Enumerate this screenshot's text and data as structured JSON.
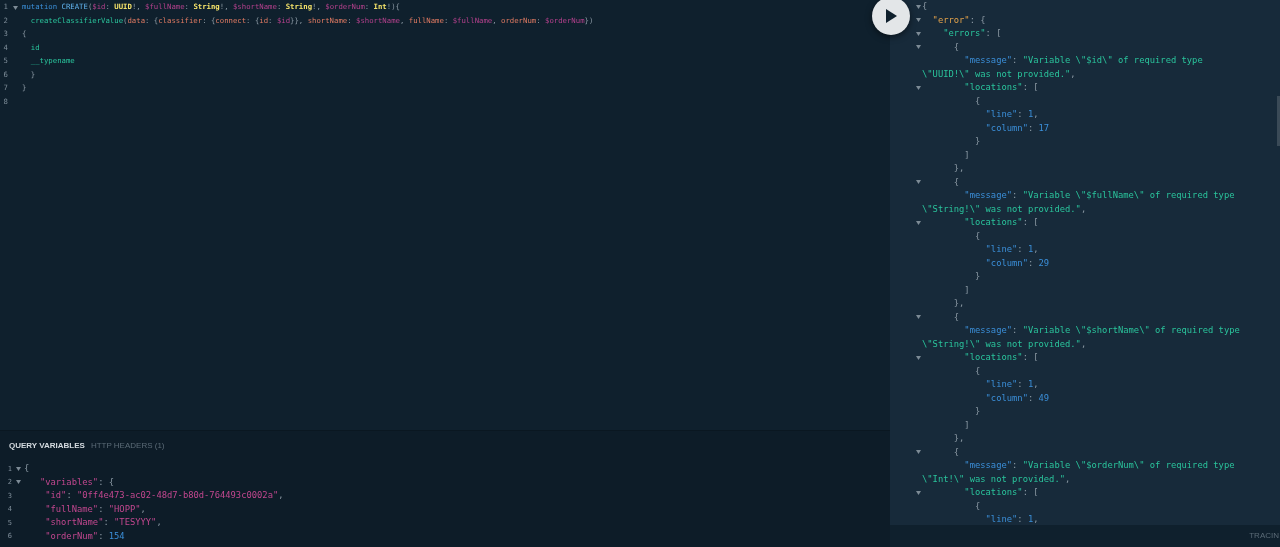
{
  "query_editor": {
    "lines": [
      {
        "number": "1",
        "fold": true,
        "tokens": [
          {
            "kind": "keyword",
            "text": "mutation "
          },
          {
            "kind": "def",
            "text": "CREATE"
          },
          {
            "kind": "punct",
            "text": "("
          },
          {
            "kind": "variable",
            "text": "$id"
          },
          {
            "kind": "punct",
            "text": ": "
          },
          {
            "kind": "type",
            "text": "UUID"
          },
          {
            "kind": "punct",
            "text": "!, "
          },
          {
            "kind": "variable",
            "text": "$fullName"
          },
          {
            "kind": "punct",
            "text": ": "
          },
          {
            "kind": "type",
            "text": "String"
          },
          {
            "kind": "punct",
            "text": "!, "
          },
          {
            "kind": "variable",
            "text": "$shortName"
          },
          {
            "kind": "punct",
            "text": ": "
          },
          {
            "kind": "type",
            "text": "String"
          },
          {
            "kind": "punct",
            "text": "!, "
          },
          {
            "kind": "variable",
            "text": "$orderNum"
          },
          {
            "kind": "punct",
            "text": ": "
          },
          {
            "kind": "type",
            "text": "Int"
          },
          {
            "kind": "punct",
            "text": "!){"
          }
        ]
      },
      {
        "number": "2",
        "fold": false,
        "tokens": [
          {
            "kind": "field",
            "text": "  createClassifierValue"
          },
          {
            "kind": "punct",
            "text": "("
          },
          {
            "kind": "arg",
            "text": "data"
          },
          {
            "kind": "punct",
            "text": ": {"
          },
          {
            "kind": "arg",
            "text": "classifier"
          },
          {
            "kind": "punct",
            "text": ": {"
          },
          {
            "kind": "arg",
            "text": "connect"
          },
          {
            "kind": "punct",
            "text": ": {"
          },
          {
            "kind": "arg",
            "text": "id"
          },
          {
            "kind": "punct",
            "text": ": "
          },
          {
            "kind": "variable",
            "text": "$id"
          },
          {
            "kind": "punct",
            "text": "}}, "
          },
          {
            "kind": "arg",
            "text": "shortName"
          },
          {
            "kind": "punct",
            "text": ": "
          },
          {
            "kind": "variable",
            "text": "$shortName"
          },
          {
            "kind": "punct",
            "text": ", "
          },
          {
            "kind": "arg",
            "text": "fullName"
          },
          {
            "kind": "punct",
            "text": ": "
          },
          {
            "kind": "variable",
            "text": "$fullName"
          },
          {
            "kind": "punct",
            "text": ", "
          },
          {
            "kind": "arg",
            "text": "orderNum"
          },
          {
            "kind": "punct",
            "text": ": "
          },
          {
            "kind": "variable",
            "text": "$orderNum"
          },
          {
            "kind": "punct",
            "text": "})"
          }
        ]
      },
      {
        "number": "3",
        "fold": false,
        "tokens": [
          {
            "kind": "punct",
            "text": "{"
          }
        ]
      },
      {
        "number": "4",
        "fold": false,
        "tokens": [
          {
            "kind": "field",
            "text": "  id"
          }
        ]
      },
      {
        "number": "5",
        "fold": false,
        "tokens": [
          {
            "kind": "field",
            "text": "  __typename"
          }
        ]
      },
      {
        "number": "6",
        "fold": false,
        "tokens": [
          {
            "kind": "punct",
            "text": "  }"
          }
        ]
      },
      {
        "number": "7",
        "fold": false,
        "tokens": [
          {
            "kind": "punct",
            "text": "}"
          }
        ]
      },
      {
        "number": "8",
        "fold": false
      }
    ]
  },
  "variables_pane": {
    "tabs": [
      {
        "label": "QUERY VARIABLES",
        "selected": true
      },
      {
        "label": "HTTP HEADERS (1)",
        "selected": false
      }
    ],
    "lines": [
      {
        "number": "1",
        "fold": true,
        "tokens": [
          {
            "kind": "punct",
            "text": "{"
          }
        ]
      },
      {
        "number": "2",
        "fold": true,
        "tokens": [
          {
            "kind": "key",
            "text": "   \"variables\""
          },
          {
            "kind": "punct",
            "text": ": {"
          }
        ]
      },
      {
        "number": "3",
        "fold": false,
        "tokens": [
          {
            "kind": "key",
            "text": "    \"id\""
          },
          {
            "kind": "punct",
            "text": ": "
          },
          {
            "kind": "string",
            "text": "\"0ff4e473-ac02-48d7-b80d-764493c0002a\""
          },
          {
            "kind": "punct",
            "text": ","
          }
        ]
      },
      {
        "number": "4",
        "fold": false,
        "tokens": [
          {
            "kind": "key",
            "text": "    \"fullName\""
          },
          {
            "kind": "punct",
            "text": ": "
          },
          {
            "kind": "string",
            "text": "\"HOPP\""
          },
          {
            "kind": "punct",
            "text": ","
          }
        ]
      },
      {
        "number": "5",
        "fold": false,
        "tokens": [
          {
            "kind": "key",
            "text": "    \"shortName\""
          },
          {
            "kind": "punct",
            "text": ": "
          },
          {
            "kind": "string",
            "text": "\"TESYYY\""
          },
          {
            "kind": "punct",
            "text": ","
          }
        ]
      },
      {
        "number": "6",
        "fold": false,
        "tokens": [
          {
            "kind": "key",
            "text": "    \"orderNum\""
          },
          {
            "kind": "punct",
            "text": ": "
          },
          {
            "kind": "number",
            "text": "154"
          }
        ]
      }
    ]
  },
  "result_pane": {
    "lines": [
      {
        "fold": true,
        "tokens": [
          {
            "kind": "punct",
            "text": "{"
          }
        ]
      },
      {
        "fold": true,
        "tokens": [
          {
            "kind": "attr",
            "text": "  \"error\""
          },
          {
            "kind": "punct",
            "text": ": {"
          }
        ]
      },
      {
        "fold": true,
        "tokens": [
          {
            "kind": "key",
            "text": "    \"errors\""
          },
          {
            "kind": "punct",
            "text": ": ["
          }
        ]
      },
      {
        "fold": true,
        "tokens": [
          {
            "kind": "punct",
            "text": "      {"
          }
        ]
      },
      {
        "fold": false,
        "tokens": [
          {
            "kind": "prop",
            "text": "        \"message\""
          },
          {
            "kind": "punct",
            "text": ": "
          },
          {
            "kind": "string",
            "text": "\"Variable \\\"$id\\\" of required type"
          }
        ]
      },
      {
        "fold": false,
        "tokens": [
          {
            "kind": "string",
            "text": "\\\"UUID!\\\" was not provided.\""
          },
          {
            "kind": "punct",
            "text": ","
          }
        ]
      },
      {
        "fold": true,
        "tokens": [
          {
            "kind": "key",
            "text": "        \"locations\""
          },
          {
            "kind": "punct",
            "text": ": ["
          }
        ]
      },
      {
        "fold": false,
        "tokens": [
          {
            "kind": "punct",
            "text": "          {"
          }
        ]
      },
      {
        "fold": false,
        "tokens": [
          {
            "kind": "prop",
            "text": "            \"line\""
          },
          {
            "kind": "punct",
            "text": ": "
          },
          {
            "kind": "number",
            "text": "1"
          },
          {
            "kind": "punct",
            "text": ","
          }
        ]
      },
      {
        "fold": false,
        "tokens": [
          {
            "kind": "prop",
            "text": "            \"column\""
          },
          {
            "kind": "punct",
            "text": ": "
          },
          {
            "kind": "number",
            "text": "17"
          }
        ]
      },
      {
        "fold": false,
        "tokens": [
          {
            "kind": "punct",
            "text": "          }"
          }
        ]
      },
      {
        "fold": false,
        "tokens": [
          {
            "kind": "punct",
            "text": "        ]"
          }
        ]
      },
      {
        "fold": false,
        "tokens": [
          {
            "kind": "punct",
            "text": "      },"
          }
        ]
      },
      {
        "fold": true,
        "tokens": [
          {
            "kind": "punct",
            "text": "      {"
          }
        ]
      },
      {
        "fold": false,
        "tokens": [
          {
            "kind": "prop",
            "text": "        \"message\""
          },
          {
            "kind": "punct",
            "text": ": "
          },
          {
            "kind": "string",
            "text": "\"Variable \\\"$fullName\\\" of required type"
          }
        ]
      },
      {
        "fold": false,
        "tokens": [
          {
            "kind": "string",
            "text": "\\\"String!\\\" was not provided.\""
          },
          {
            "kind": "punct",
            "text": ","
          }
        ]
      },
      {
        "fold": true,
        "tokens": [
          {
            "kind": "key",
            "text": "        \"locations\""
          },
          {
            "kind": "punct",
            "text": ": ["
          }
        ]
      },
      {
        "fold": false,
        "tokens": [
          {
            "kind": "punct",
            "text": "          {"
          }
        ]
      },
      {
        "fold": false,
        "tokens": [
          {
            "kind": "prop",
            "text": "            \"line\""
          },
          {
            "kind": "punct",
            "text": ": "
          },
          {
            "kind": "number",
            "text": "1"
          },
          {
            "kind": "punct",
            "text": ","
          }
        ]
      },
      {
        "fold": false,
        "tokens": [
          {
            "kind": "prop",
            "text": "            \"column\""
          },
          {
            "kind": "punct",
            "text": ": "
          },
          {
            "kind": "number",
            "text": "29"
          }
        ]
      },
      {
        "fold": false,
        "tokens": [
          {
            "kind": "punct",
            "text": "          }"
          }
        ]
      },
      {
        "fold": false,
        "tokens": [
          {
            "kind": "punct",
            "text": "        ]"
          }
        ]
      },
      {
        "fold": false,
        "tokens": [
          {
            "kind": "punct",
            "text": "      },"
          }
        ]
      },
      {
        "fold": true,
        "tokens": [
          {
            "kind": "punct",
            "text": "      {"
          }
        ]
      },
      {
        "fold": false,
        "tokens": [
          {
            "kind": "prop",
            "text": "        \"message\""
          },
          {
            "kind": "punct",
            "text": ": "
          },
          {
            "kind": "string",
            "text": "\"Variable \\\"$shortName\\\" of required type"
          }
        ]
      },
      {
        "fold": false,
        "tokens": [
          {
            "kind": "string",
            "text": "\\\"String!\\\" was not provided.\""
          },
          {
            "kind": "punct",
            "text": ","
          }
        ]
      },
      {
        "fold": true,
        "tokens": [
          {
            "kind": "key",
            "text": "        \"locations\""
          },
          {
            "kind": "punct",
            "text": ": ["
          }
        ]
      },
      {
        "fold": false,
        "tokens": [
          {
            "kind": "punct",
            "text": "          {"
          }
        ]
      },
      {
        "fold": false,
        "tokens": [
          {
            "kind": "prop",
            "text": "            \"line\""
          },
          {
            "kind": "punct",
            "text": ": "
          },
          {
            "kind": "number",
            "text": "1"
          },
          {
            "kind": "punct",
            "text": ","
          }
        ]
      },
      {
        "fold": false,
        "tokens": [
          {
            "kind": "prop",
            "text": "            \"column\""
          },
          {
            "kind": "punct",
            "text": ": "
          },
          {
            "kind": "number",
            "text": "49"
          }
        ]
      },
      {
        "fold": false,
        "tokens": [
          {
            "kind": "punct",
            "text": "          }"
          }
        ]
      },
      {
        "fold": false,
        "tokens": [
          {
            "kind": "punct",
            "text": "        ]"
          }
        ]
      },
      {
        "fold": false,
        "tokens": [
          {
            "kind": "punct",
            "text": "      },"
          }
        ]
      },
      {
        "fold": true,
        "tokens": [
          {
            "kind": "punct",
            "text": "      {"
          }
        ]
      },
      {
        "fold": false,
        "tokens": [
          {
            "kind": "prop",
            "text": "        \"message\""
          },
          {
            "kind": "punct",
            "text": ": "
          },
          {
            "kind": "string",
            "text": "\"Variable \\\"$orderNum\\\" of required type"
          }
        ]
      },
      {
        "fold": false,
        "tokens": [
          {
            "kind": "string",
            "text": "\\\"Int!\\\" was not provided.\""
          },
          {
            "kind": "punct",
            "text": ","
          }
        ]
      },
      {
        "fold": true,
        "tokens": [
          {
            "kind": "key",
            "text": "        \"locations\""
          },
          {
            "kind": "punct",
            "text": ": ["
          }
        ]
      },
      {
        "fold": false,
        "tokens": [
          {
            "kind": "punct",
            "text": "          {"
          }
        ]
      },
      {
        "fold": false,
        "tokens": [
          {
            "kind": "prop",
            "text": "            \"line\""
          },
          {
            "kind": "punct",
            "text": ": "
          },
          {
            "kind": "number",
            "text": "1"
          },
          {
            "kind": "punct",
            "text": ","
          }
        ]
      }
    ]
  },
  "footer": {
    "tracing_label": "TRACIN"
  }
}
